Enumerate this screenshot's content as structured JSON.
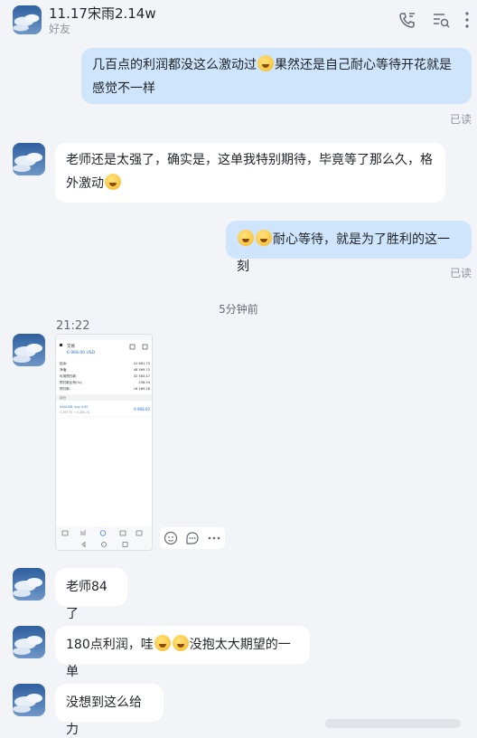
{
  "header": {
    "title": "11.17宋雨2.14w",
    "subtitle": "好友",
    "icons": [
      "phone-icon",
      "list-search-icon",
      "more-icon"
    ]
  },
  "messages": {
    "m1": {
      "text_a": "几百点的利润都没这么激动过",
      "text_b": "果然还是自己耐心等待开花就是",
      "text_c": "感觉不一样",
      "status": "已读"
    },
    "m2": {
      "text_a": "老师还是太强了，确实是，这单我特别期待，毕竟等了那么久，格",
      "text_b": "外激动"
    },
    "m3": {
      "text": "耐心等待，就是为了胜利的这一刻",
      "status": "已读"
    },
    "separator": "5分钟前",
    "image_time": "21:22",
    "m5": {
      "text": "老师84了"
    },
    "m6": {
      "text_a": "180点利润，哇",
      "text_b": "没抱太大期望的一单"
    },
    "m7": {
      "text": "没想到这么给力"
    }
  },
  "screenshot": {
    "header_label": "交易",
    "balance": "6 968.00 USD",
    "rows": [
      {
        "label": "结余:",
        "value": "41 681.75"
      },
      {
        "label": "净值:",
        "value": "48 569.75"
      },
      {
        "label": "可用预付款:",
        "value": "32 583.47"
      },
      {
        "label": "预付款比例(%):",
        "value": "298.54"
      },
      {
        "label": "预付款:",
        "value": "16 269.28"
      }
    ],
    "position_label": "持仓",
    "position_symbol": "XAUUSD, buy 4.00",
    "position_detail": "4 267.32 → 4 284.74",
    "position_profit": "6 968.00"
  },
  "colors": {
    "out_bubble": "#cfe5fb",
    "in_bubble": "#ffffff",
    "background": "#f3f4f7"
  }
}
